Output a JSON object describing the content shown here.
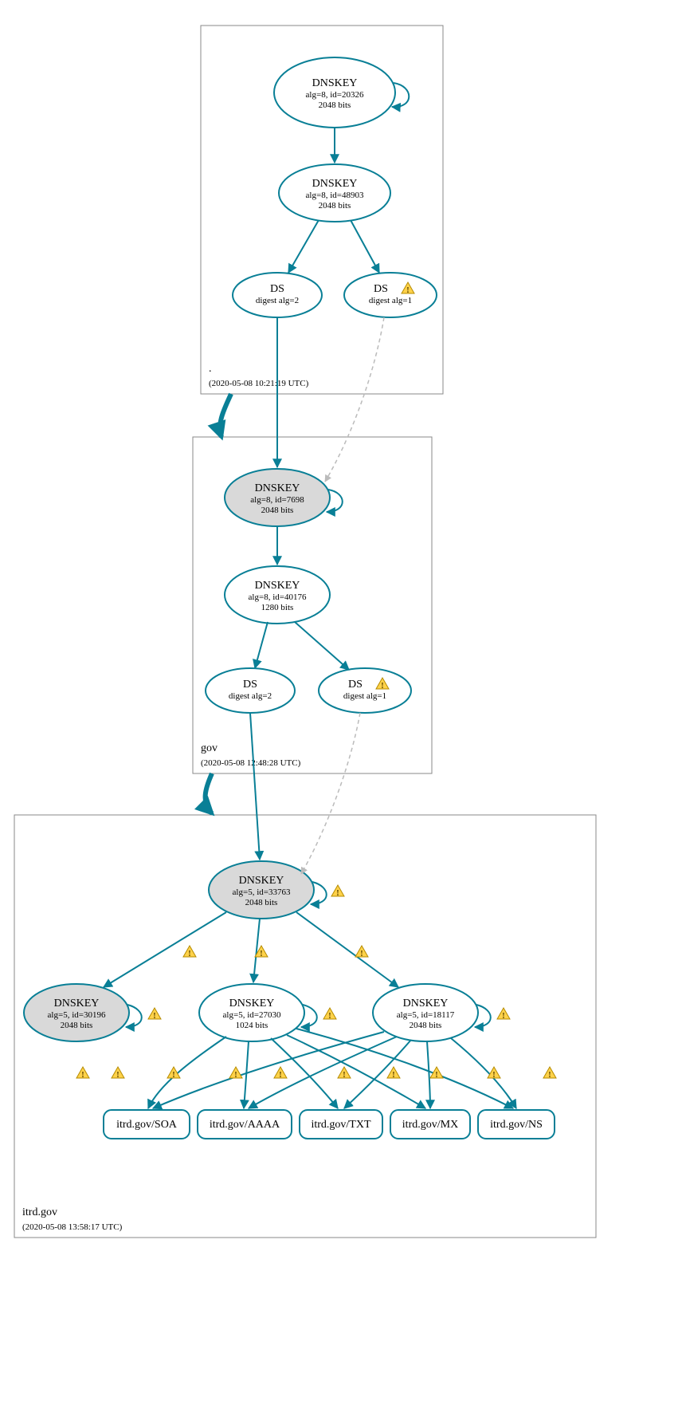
{
  "zones": {
    "root": {
      "label": ".",
      "timestamp": "(2020-05-08 10:21:19 UTC)"
    },
    "gov": {
      "label": "gov",
      "timestamp": "(2020-05-08 12:48:28 UTC)"
    },
    "itrd": {
      "label": "itrd.gov",
      "timestamp": "(2020-05-08 13:58:17 UTC)"
    }
  },
  "nodes": {
    "root_ksk": {
      "title": "DNSKEY",
      "line2": "alg=8, id=20326",
      "line3": "2048 bits"
    },
    "root_zsk": {
      "title": "DNSKEY",
      "line2": "alg=8, id=48903",
      "line3": "2048 bits"
    },
    "root_ds2": {
      "title": "DS",
      "line2": "digest alg=2"
    },
    "root_ds1": {
      "title": "DS",
      "line2": "digest alg=1"
    },
    "gov_ksk": {
      "title": "DNSKEY",
      "line2": "alg=8, id=7698",
      "line3": "2048 bits"
    },
    "gov_zsk": {
      "title": "DNSKEY",
      "line2": "alg=8, id=40176",
      "line3": "1280 bits"
    },
    "gov_ds2": {
      "title": "DS",
      "line2": "digest alg=2"
    },
    "gov_ds1": {
      "title": "DS",
      "line2": "digest alg=1"
    },
    "itrd_ksk": {
      "title": "DNSKEY",
      "line2": "alg=5, id=33763",
      "line3": "2048 bits"
    },
    "itrd_k1": {
      "title": "DNSKEY",
      "line2": "alg=5, id=30196",
      "line3": "2048 bits"
    },
    "itrd_k2": {
      "title": "DNSKEY",
      "line2": "alg=5, id=27030",
      "line3": "1024 bits"
    },
    "itrd_k3": {
      "title": "DNSKEY",
      "line2": "alg=5, id=18117",
      "line3": "2048 bits"
    },
    "rr_soa": {
      "title": "itrd.gov/SOA"
    },
    "rr_aaaa": {
      "title": "itrd.gov/AAAA"
    },
    "rr_txt": {
      "title": "itrd.gov/TXT"
    },
    "rr_mx": {
      "title": "itrd.gov/MX"
    },
    "rr_ns": {
      "title": "itrd.gov/NS"
    }
  }
}
